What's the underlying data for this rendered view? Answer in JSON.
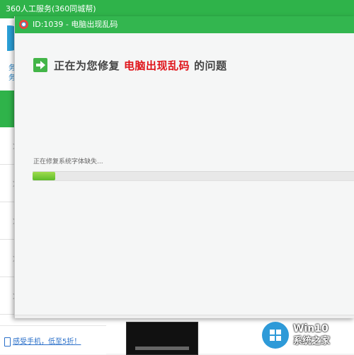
{
  "background_window": {
    "title": "360人工服务(360同城帮)",
    "side_text": "务务",
    "footer_link": "感受手机，低至5折！"
  },
  "dialog": {
    "title": "ID:1039 - 电脑出现乱码",
    "heading_prefix": "正在为您修复",
    "heading_highlight": "电脑出现乱码",
    "heading_suffix": "的问题",
    "status_text": "正在修复系统字体缺失...",
    "progress_fraction": 0.07
  },
  "watermark": {
    "line1": "Win10",
    "line2": "系统之家"
  },
  "colors": {
    "title_green": "#33b64f",
    "highlight_red": "#e0141a",
    "progress_green": "#5dbb2a",
    "watermark_blue": "#2e9ad8"
  },
  "icons": [
    "lifebuoy-icon",
    "arrow-right-icon",
    "phone-icon",
    "windows-logo-icon"
  ]
}
